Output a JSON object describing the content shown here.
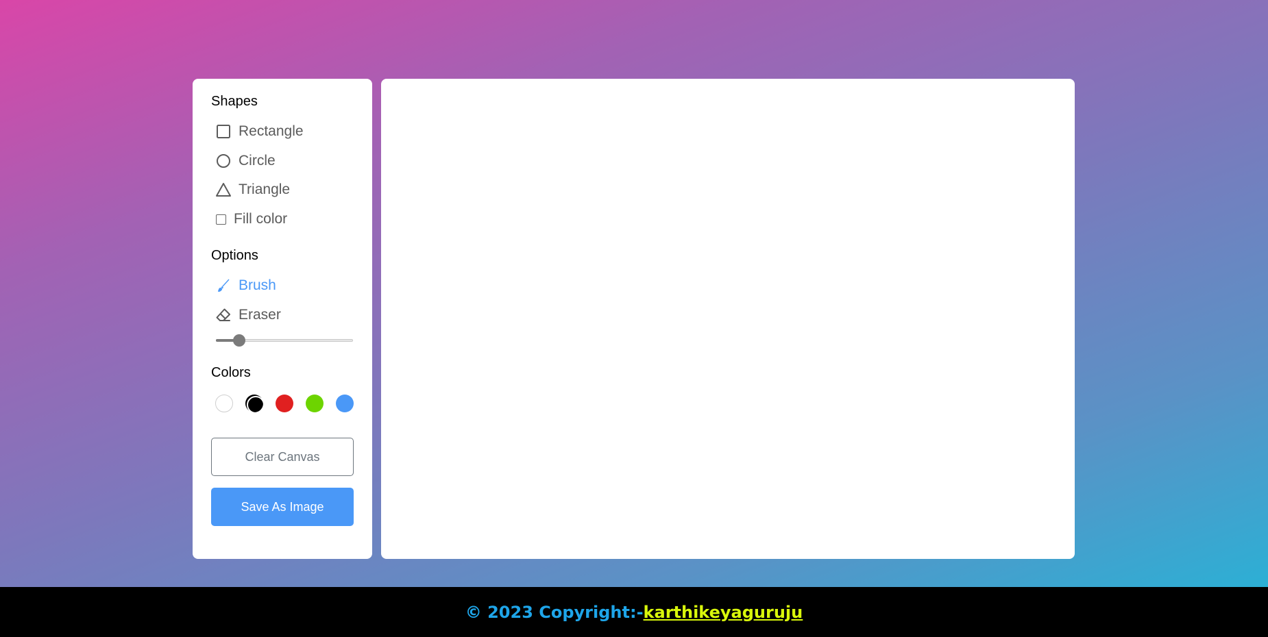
{
  "sidebar": {
    "shapes_title": "Shapes",
    "shapes": [
      {
        "label": "Rectangle",
        "icon": "rectangle-icon"
      },
      {
        "label": "Circle",
        "icon": "circle-icon"
      },
      {
        "label": "Triangle",
        "icon": "triangle-icon"
      }
    ],
    "fill_color_label": "Fill color",
    "fill_color_checked": false,
    "options_title": "Options",
    "options": [
      {
        "label": "Brush",
        "icon": "brush-icon",
        "active": true
      },
      {
        "label": "Eraser",
        "icon": "eraser-icon",
        "active": false
      }
    ],
    "brush_size_fraction": 0.14,
    "colors_title": "Colors",
    "colors": [
      "#ffffff",
      "#000000",
      "#e02020",
      "#6dd400",
      "#4a98f7"
    ],
    "selected_color_index": 1,
    "clear_button": "Clear Canvas",
    "save_button": "Save As Image",
    "accent_color": "#4a98f7"
  },
  "footer": {
    "copyright": "© 2023 Copyright:-",
    "author": "karthikeyaguruju"
  }
}
